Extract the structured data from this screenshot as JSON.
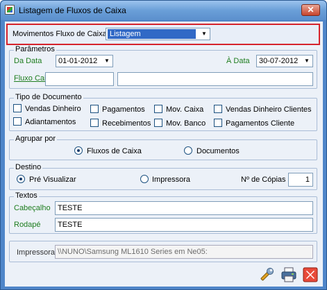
{
  "window": {
    "title": "Listagem de Fluxos de Caixa",
    "close_glyph": "✕"
  },
  "movimentos": {
    "label": "Movimentos Fluxo de Caixa",
    "value": "Listagem"
  },
  "parametros": {
    "legend": "Parâmetros",
    "da_data_label": "Da Data",
    "da_data_value": "01-01-2012",
    "a_data_label": "À Data",
    "a_data_value": "30-07-2012",
    "fluxo_caixa_label": "Fluxo Caixa",
    "fluxo_code": "",
    "fluxo_desc": ""
  },
  "tipo_documento": {
    "legend": "Tipo de Documento",
    "items": [
      {
        "label": "Vendas Dinheiro",
        "checked": false
      },
      {
        "label": "Pagamentos",
        "checked": false
      },
      {
        "label": "Mov. Caixa",
        "checked": false
      },
      {
        "label": "Vendas Dinheiro Clientes",
        "checked": false
      },
      {
        "label": "Adiantamentos",
        "checked": false
      },
      {
        "label": "Recebimentos",
        "checked": false
      },
      {
        "label": "Mov. Banco",
        "checked": false
      },
      {
        "label": "Pagamentos Cliente",
        "checked": false
      }
    ]
  },
  "agrupar": {
    "legend": "Agrupar por",
    "options": [
      {
        "label": "Fluxos de Caixa",
        "selected": true
      },
      {
        "label": "Documentos",
        "selected": false
      }
    ]
  },
  "destino": {
    "legend": "Destino",
    "options": [
      {
        "label": "Pré Visualizar",
        "selected": true
      },
      {
        "label": "Impressora",
        "selected": false
      }
    ],
    "copias_label": "Nº de Cópias",
    "copias_value": "1"
  },
  "textos": {
    "legend": "Textos",
    "cabecalho_label": "Cabeçalho",
    "cabecalho_value": "TESTE",
    "rodape_label": "Rodapé",
    "rodape_value": "TESTE"
  },
  "impressora": {
    "label": "Impressora",
    "value": "\\\\NUNO\\Samsung ML1610 Series em Ne05:"
  },
  "icons": {
    "settings": "wrench-icon",
    "print": "printer-icon",
    "close": "close-x-icon"
  },
  "colors": {
    "title_bar": "#6a9fd8",
    "client_bg": "#ecf1f8",
    "highlight": "#d6232c",
    "label_green": "#1e7d1e",
    "selection": "#3169c6"
  }
}
